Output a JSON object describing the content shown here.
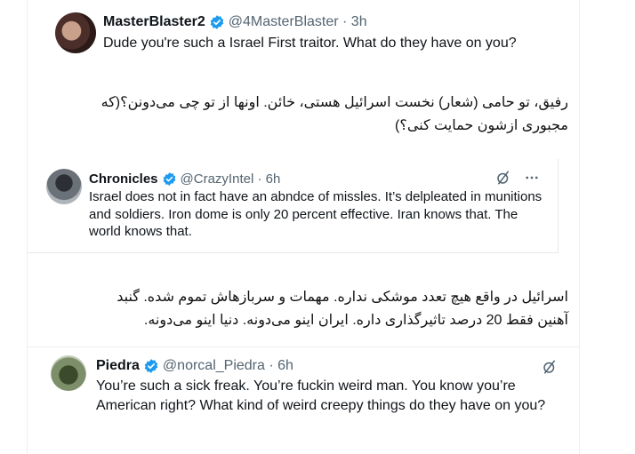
{
  "tweet_main": {
    "name": "MasterBlaster2",
    "handle": "@4MasterBlaster · 3h",
    "text": "Dude you're such a Israel First traitor. What do they have on you?"
  },
  "translation_1": {
    "line1": "رفیق، تو حامی (شعار) نخست اسرائیل هستی، خائن. اونها از تو چی می‌دونن؟(که",
    "line2": "مجبوری ازشون حمایت کنی؟)"
  },
  "quoted_tweet": {
    "name": "Chronicles",
    "handle": "@CrazyIntel · 6h",
    "text": "Israel does not in fact have an abndce of missles. It’s delpleated in munitions and soldiers. Iron dome is only 20 percent effective. Iran knows that. The world knows that."
  },
  "translation_2": {
    "line1": "اسرائیل در واقع هیچ تعدد موشکی نداره. مهمات و سربازهاش تموم شده. گنبد",
    "line2": "آهنین فقط 20 درصد تاثیرگذاری داره. ایران اینو می‌دونه. دنیا اینو می‌دونه."
  },
  "tweet_reply": {
    "name": "Piedra",
    "handle": "@norcal_Piedra · 6h",
    "text": "You’re such a sick freak. You’re fuckin weird man. You know you’re American right? What kind of weird creepy things do they have on you?"
  },
  "icons": {
    "verified": "verified-badge-icon",
    "grok": "grok-icon",
    "more": "more-icon"
  },
  "colors": {
    "verified": "#1d9bf0",
    "secondary_text": "#536471"
  }
}
